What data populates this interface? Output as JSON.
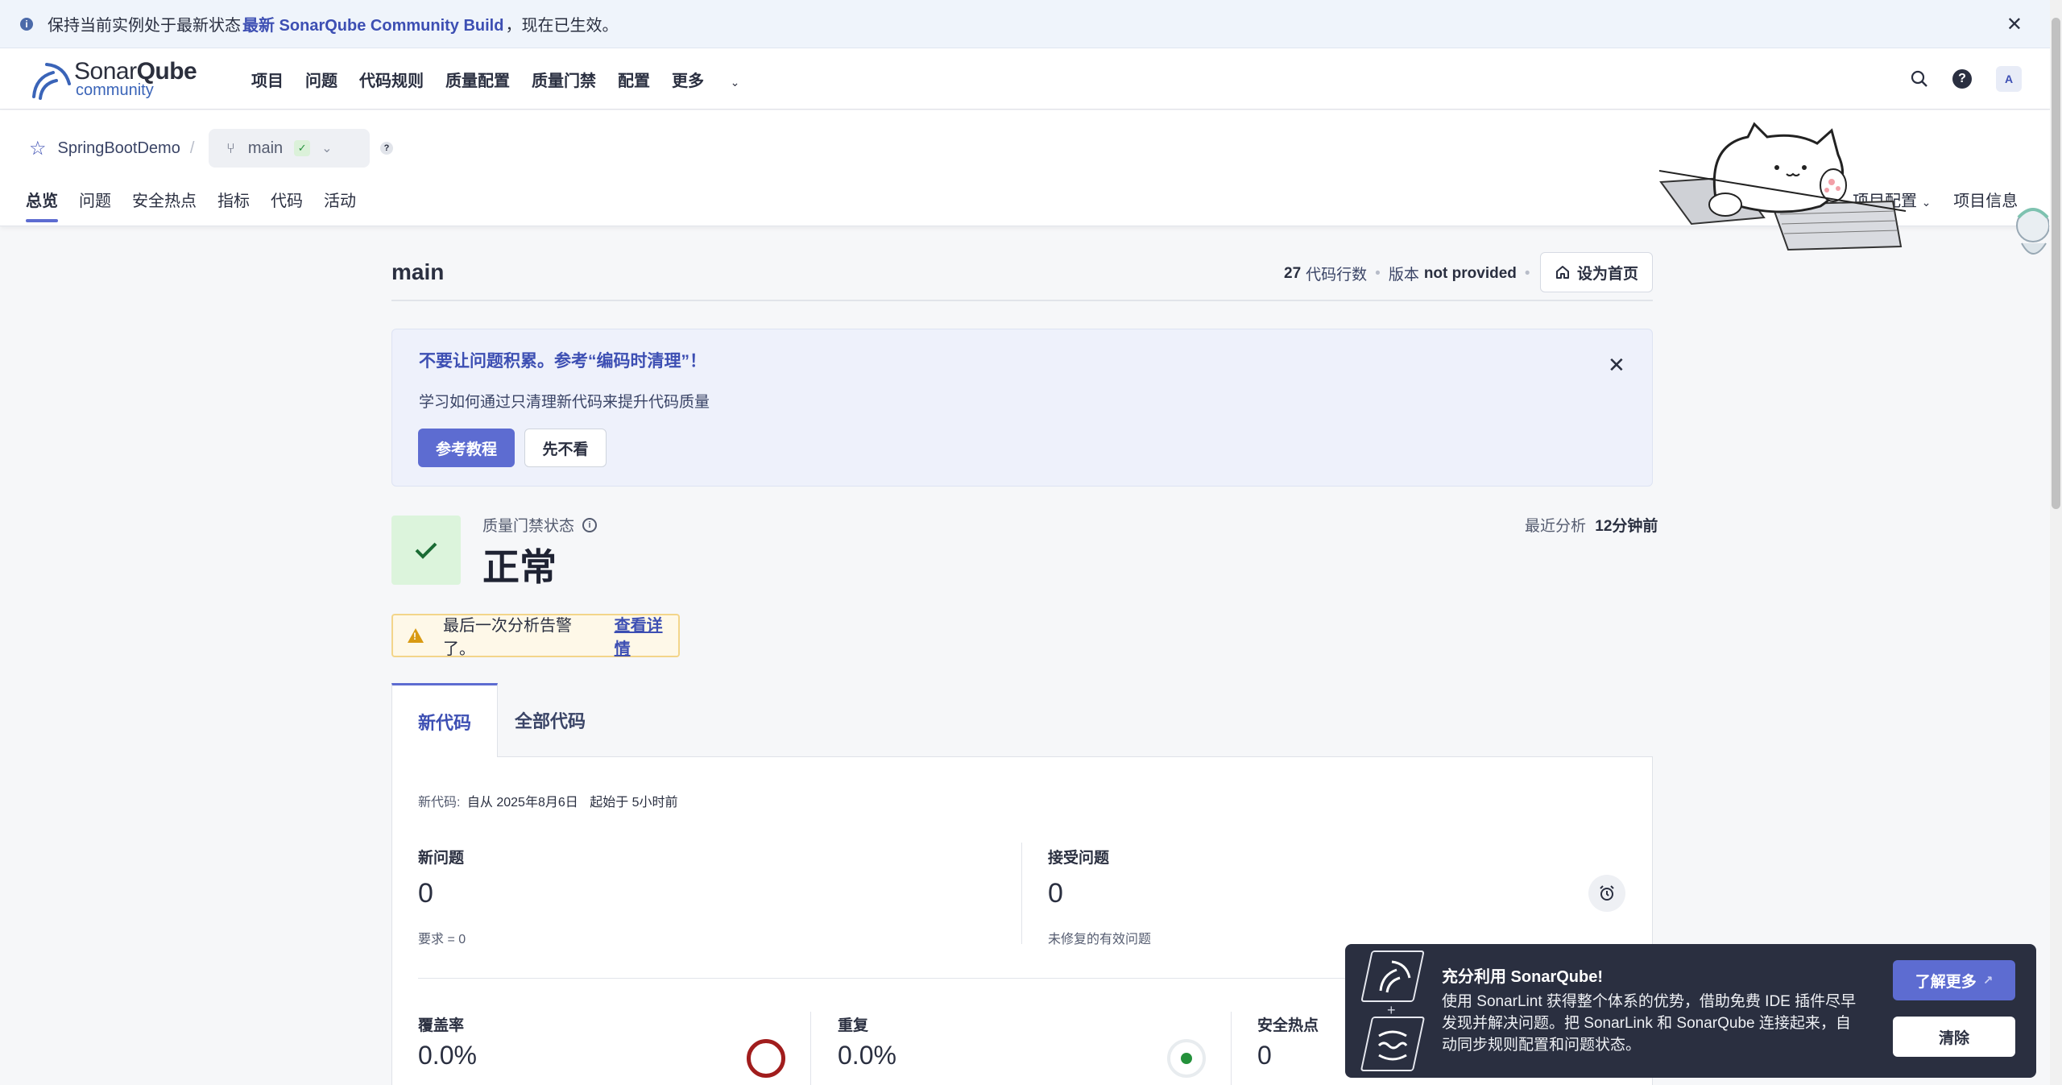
{
  "banner": {
    "text_before": "保持当前实例处于最新状态",
    "link": "最新 SonarQube Community Build",
    "text_after": "，现在已生效。"
  },
  "logo": {
    "name_light": "Sonar",
    "name_bold": "Qube",
    "edition": "community"
  },
  "menu": [
    "项目",
    "问题",
    "代码规则",
    "质量配置",
    "质量门禁",
    "配置",
    "更多"
  ],
  "user": {
    "avatar": "A"
  },
  "project": {
    "name": "SpringBootDemo",
    "branch": "main",
    "tabs": [
      "总览",
      "问题",
      "安全热点",
      "指标",
      "代码",
      "活动"
    ],
    "right_links": [
      "项目配置",
      "项目信息"
    ]
  },
  "main": {
    "title": "main",
    "loc_count": "27",
    "loc_label": "代码行数",
    "version_label": "版本",
    "version_value": "not provided",
    "home_button": "设为首页"
  },
  "promo": {
    "title": "不要让问题积累。参考“编码时清理”！",
    "subtitle": "学习如何通过只清理新代码来提升代码质量",
    "primary": "参考教程",
    "secondary": "先不看"
  },
  "quality_gate": {
    "label": "质量门禁状态",
    "status": "正常",
    "last_analysis_label": "最近分析",
    "last_analysis_value": "12分钟前"
  },
  "warning": {
    "text": "最后一次分析告警了。",
    "link": "查看详情"
  },
  "code_tabs": [
    "新代码",
    "全部代码"
  ],
  "new_code": {
    "since_label": "新代码:",
    "since_value": "自从 2025年8月6日",
    "started": "起始于 5小时前"
  },
  "metrics": {
    "new_issues": {
      "label": "新问题",
      "value": "0",
      "sub": "要求 = 0"
    },
    "accepted_issues": {
      "label": "接受问题",
      "value": "0",
      "sub": "未修复的有效问题"
    },
    "coverage": {
      "label": "覆盖率",
      "value": "0.0%"
    },
    "duplication": {
      "label": "重复",
      "value": "0.0%"
    },
    "hotspots": {
      "label": "安全热点",
      "value": "0"
    }
  },
  "toast": {
    "title": "充分利用 SonarQube!",
    "body": "使用 SonarLint 获得整个体系的优势，借助免费 IDE 插件尽早发现并解决问题。把 SonarLink 和 SonarQube 连接起来，自动同步规则配置和问题状态。",
    "learn_more": "了解更多",
    "dismiss": "清除"
  },
  "colors": {
    "accent": "#5d6cd1",
    "ok": "#24913b",
    "warn": "#d99a13",
    "error": "#a11d1d"
  }
}
